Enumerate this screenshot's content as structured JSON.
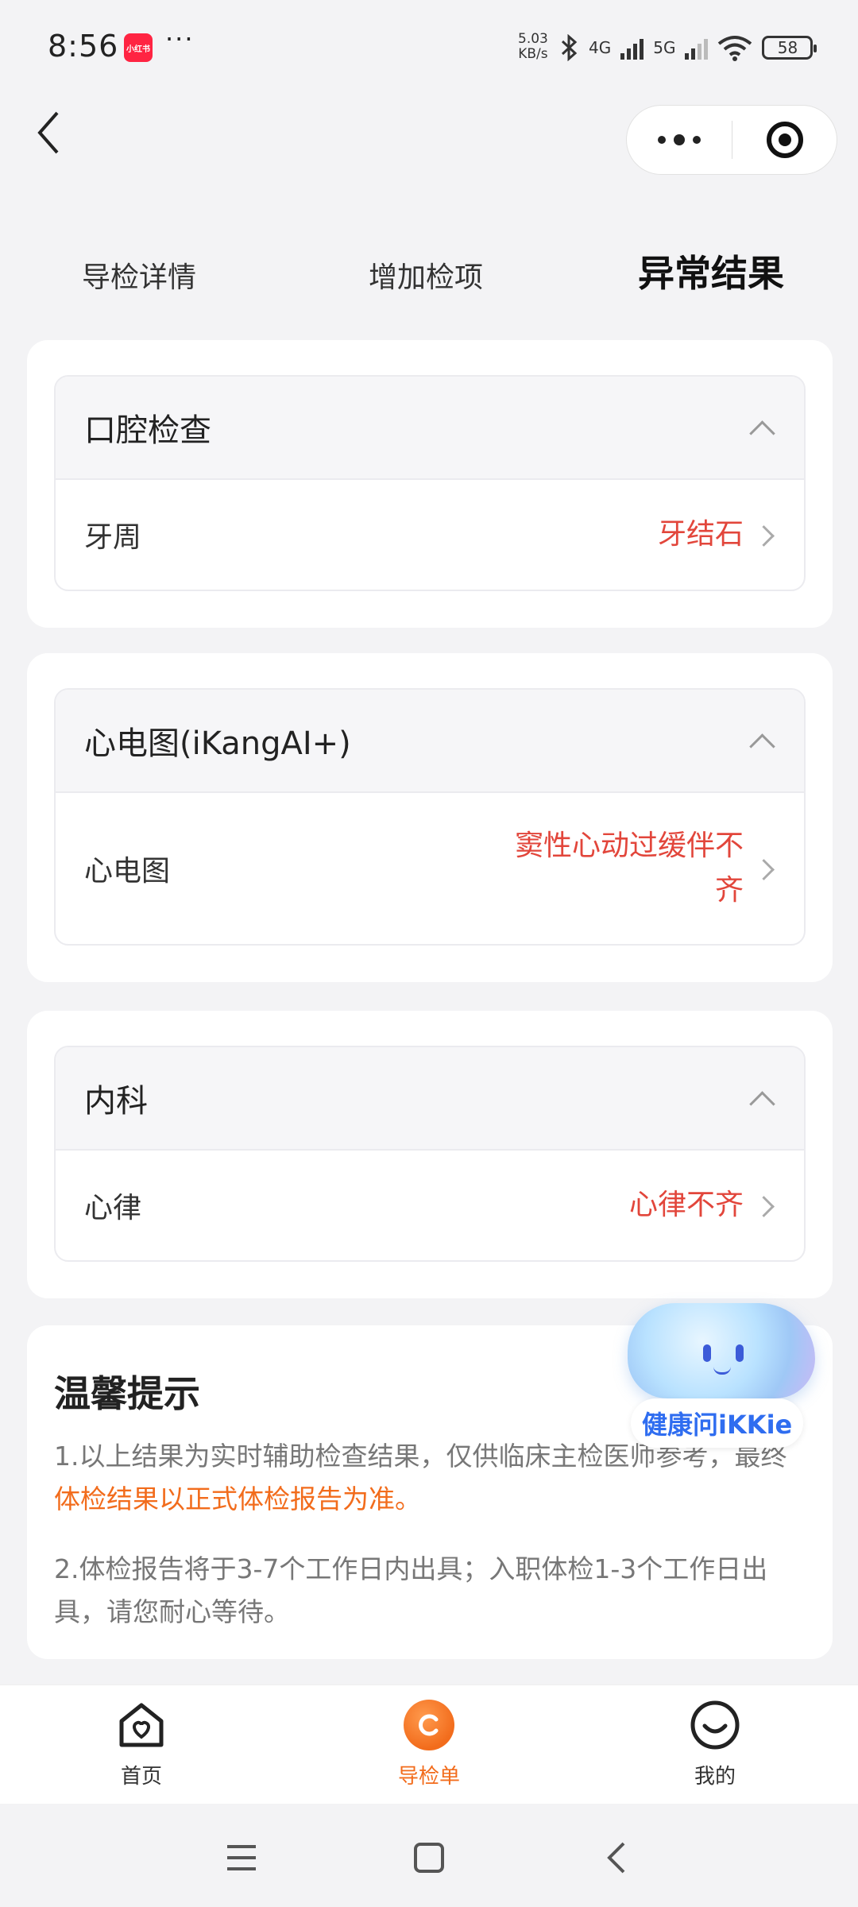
{
  "status_bar": {
    "time": "8:56",
    "app_badge": "小红书",
    "more": "···",
    "net_speed_value": "5.03",
    "net_speed_unit": "KB/s",
    "network_4g": "4G",
    "network_5g": "5G",
    "battery": "58"
  },
  "tabs": [
    {
      "label": "导检详情",
      "active": false
    },
    {
      "label": "增加检项",
      "active": false
    },
    {
      "label": "异常结果",
      "active": true
    }
  ],
  "sections": [
    {
      "title": "口腔检查",
      "row_label": "牙周",
      "row_value": "牙结石"
    },
    {
      "title": "心电图(iKangAI+)",
      "row_label": "心电图",
      "row_value_line1": "窦性心动过缓伴不",
      "row_value_line2": "齐"
    },
    {
      "title": "内科",
      "row_label": "心律",
      "row_value": "心律不齐"
    }
  ],
  "tip": {
    "title": "温馨提示",
    "p1_prefix": "1.以上结果为实时辅助检查结果，仅供临床主检医师参考，最终",
    "p1_highlight": "体检结果以正式体检报告为准。",
    "p2": "2.体检报告将于3-7个工作日内出具；入职体检1-3个工作日出具，请您耐心等待。"
  },
  "assistant": {
    "label": "健康问iKKie"
  },
  "bottom_nav": [
    {
      "label": "首页",
      "icon": "home-heart-icon",
      "active": false
    },
    {
      "label": "导检单",
      "icon": "guide-icon",
      "active": true
    },
    {
      "label": "我的",
      "icon": "smile-icon",
      "active": false
    }
  ],
  "colors": {
    "accent": "#f26c1c",
    "abnormal": "#e2463b",
    "assistant_text": "#2f6df0"
  }
}
